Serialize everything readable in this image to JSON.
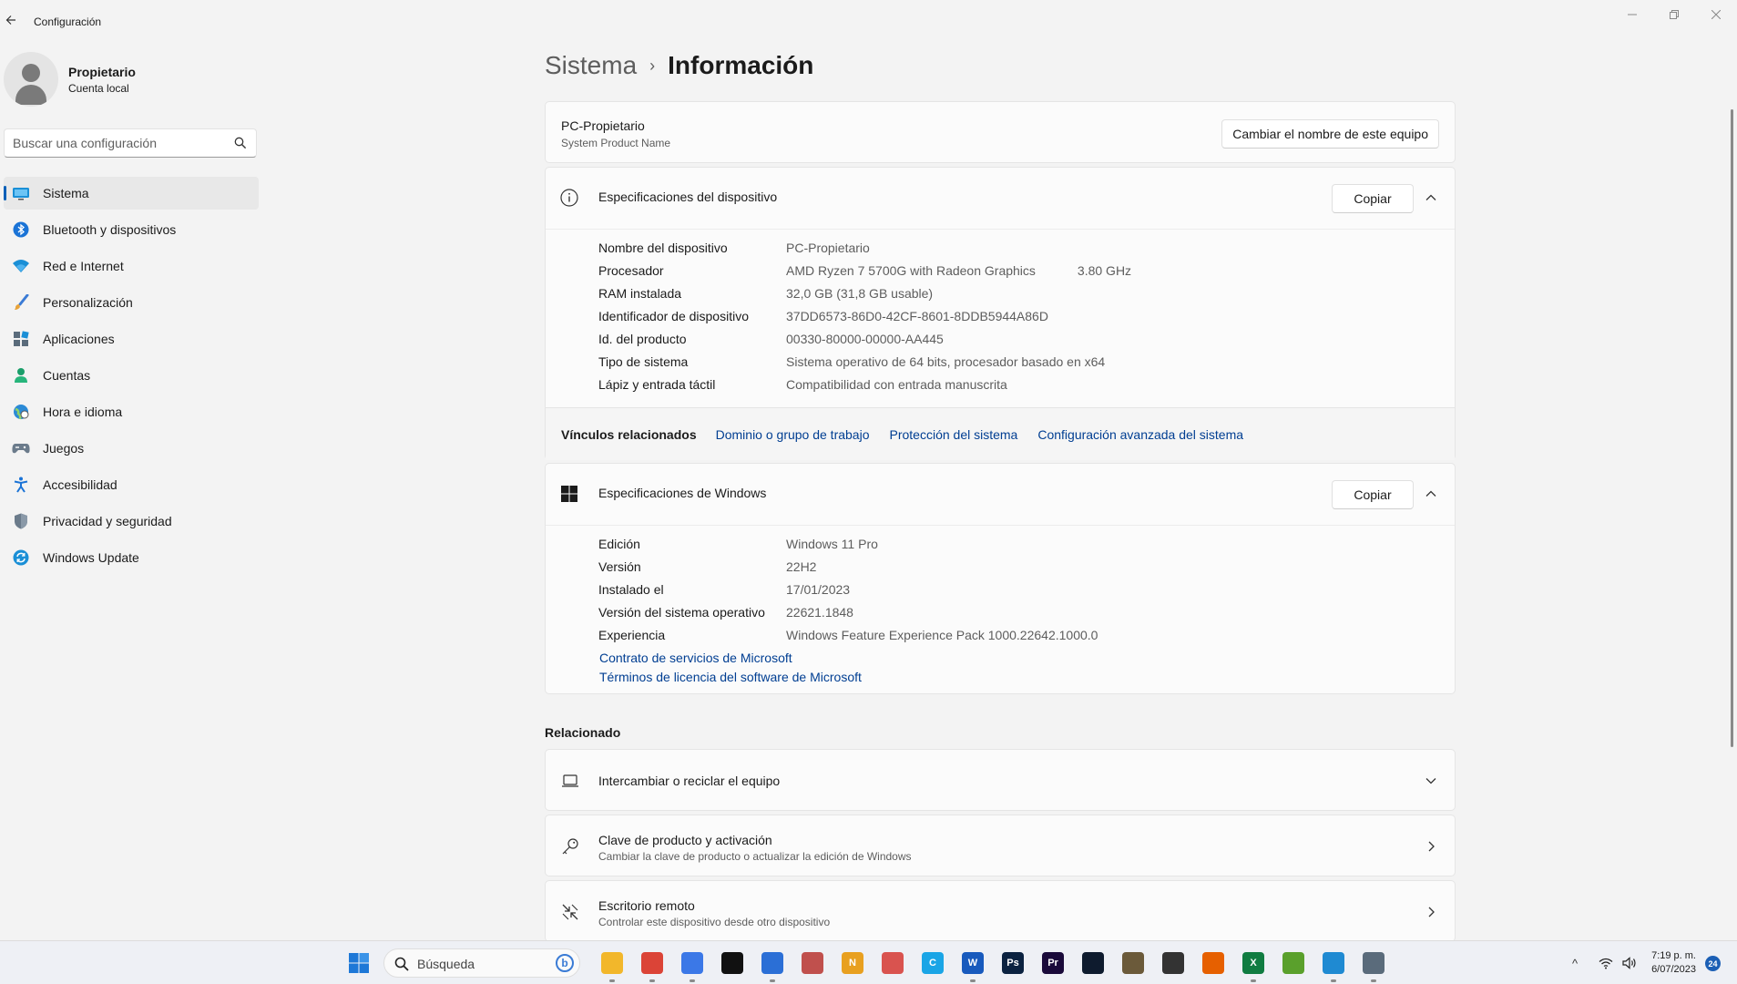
{
  "window": {
    "title": "Configuración"
  },
  "profile": {
    "name": "Propietario",
    "account_type": "Cuenta local"
  },
  "search": {
    "placeholder": "Buscar una configuración"
  },
  "sidebar": {
    "items": [
      {
        "label": "Sistema",
        "icon": "monitor-icon",
        "active": true
      },
      {
        "label": "Bluetooth y dispositivos",
        "icon": "bluetooth-icon"
      },
      {
        "label": "Red e Internet",
        "icon": "wifi-icon"
      },
      {
        "label": "Personalización",
        "icon": "brush-icon"
      },
      {
        "label": "Aplicaciones",
        "icon": "apps-icon"
      },
      {
        "label": "Cuentas",
        "icon": "person-icon"
      },
      {
        "label": "Hora e idioma",
        "icon": "globe-clock-icon"
      },
      {
        "label": "Juegos",
        "icon": "gamepad-icon"
      },
      {
        "label": "Accesibilidad",
        "icon": "accessibility-icon"
      },
      {
        "label": "Privacidad y seguridad",
        "icon": "shield-icon"
      },
      {
        "label": "Windows Update",
        "icon": "update-icon"
      }
    ]
  },
  "breadcrumb": {
    "parent": "Sistema",
    "separator": "›",
    "current": "Información"
  },
  "device_header": {
    "pc_name": "PC-Propietario",
    "product_name": "System Product Name",
    "rename_button": "Cambiar el nombre de este equipo"
  },
  "device_specs": {
    "title": "Especificaciones del dispositivo",
    "copy_button": "Copiar",
    "rows": [
      {
        "label": "Nombre del dispositivo",
        "value": "PC-Propietario"
      },
      {
        "label": "Procesador",
        "value": "AMD Ryzen 7 5700G with Radeon Graphics",
        "extra": "3.80 GHz"
      },
      {
        "label": "RAM instalada",
        "value": "32,0 GB (31,8 GB usable)"
      },
      {
        "label": "Identificador de dispositivo",
        "value": "37DD6573-86D0-42CF-8601-8DDB5944A86D"
      },
      {
        "label": "Id. del producto",
        "value": "00330-80000-00000-AA445"
      },
      {
        "label": "Tipo de sistema",
        "value": "Sistema operativo de 64 bits, procesador basado en x64"
      },
      {
        "label": "Lápiz y entrada táctil",
        "value": "Compatibilidad con entrada manuscrita"
      }
    ]
  },
  "related_links": {
    "label": "Vínculos relacionados",
    "links": [
      "Dominio o grupo de trabajo",
      "Protección del sistema",
      "Configuración avanzada del sistema"
    ]
  },
  "windows_specs": {
    "title": "Especificaciones de Windows",
    "copy_button": "Copiar",
    "rows": [
      {
        "label": "Edición",
        "value": "Windows 11 Pro"
      },
      {
        "label": "Versión",
        "value": "22H2"
      },
      {
        "label": "Instalado el",
        "value": "17/01/2023"
      },
      {
        "label": "Versión del sistema operativo",
        "value": "22621.1848"
      },
      {
        "label": "Experiencia",
        "value": "Windows Feature Experience Pack 1000.22642.1000.0"
      }
    ],
    "links": [
      "Contrato de servicios de Microsoft",
      "Términos de licencia del software de Microsoft"
    ]
  },
  "related": {
    "title": "Relacionado",
    "items": [
      {
        "title": "Intercambiar o reciclar el equipo",
        "subtitle": "",
        "icon": "laptop-icon"
      },
      {
        "title": "Clave de producto y activación",
        "subtitle": "Cambiar la clave de producto o actualizar la edición de Windows",
        "icon": "key-icon"
      },
      {
        "title": "Escritorio remoto",
        "subtitle": "Controlar este dispositivo desde otro dispositivo",
        "icon": "remote-desktop-icon"
      }
    ]
  },
  "taskbar": {
    "search_placeholder": "Búsqueda",
    "search_badge": "b",
    "apps": [
      {
        "name": "file-explorer-icon",
        "color": "#f2b72b",
        "label": ""
      },
      {
        "name": "chrome-icon",
        "color": "#db4437",
        "label": ""
      },
      {
        "name": "snipping-tool-icon",
        "color": "#3b78e7",
        "label": ""
      },
      {
        "name": "inkscape-icon",
        "color": "#111111",
        "label": ""
      },
      {
        "name": "photo-app-icon",
        "color": "#2b6fd6",
        "label": ""
      },
      {
        "name": "3d-app-icon",
        "color": "#c0504d",
        "label": ""
      },
      {
        "name": "notepad-plus-icon",
        "color": "#e8a020",
        "label": "N"
      },
      {
        "name": "sketchup-icon",
        "color": "#d9534f",
        "label": ""
      },
      {
        "name": "clipchamp-icon",
        "color": "#1aa5e6",
        "label": "C"
      },
      {
        "name": "word-icon",
        "color": "#185abd",
        "label": "W"
      },
      {
        "name": "photoshop-icon",
        "color": "#0b2240",
        "label": "Ps"
      },
      {
        "name": "premiere-icon",
        "color": "#1a0a3a",
        "label": "Pr"
      },
      {
        "name": "teamviewer-icon",
        "color": "#0e1b2e",
        "label": ""
      },
      {
        "name": "gimp-icon",
        "color": "#6b5a3a",
        "label": ""
      },
      {
        "name": "inkscape-alt-icon",
        "color": "#333333",
        "label": ""
      },
      {
        "name": "firefox-icon",
        "color": "#e66000",
        "label": ""
      },
      {
        "name": "excel-icon",
        "color": "#107c41",
        "label": "X"
      },
      {
        "name": "feather-app-icon",
        "color": "#5aa02c",
        "label": ""
      },
      {
        "name": "edge-icon",
        "color": "#1f8ad2",
        "label": ""
      },
      {
        "name": "settings-app-icon",
        "color": "#5a6b7b",
        "label": ""
      }
    ],
    "time": "7:19 p. m.",
    "date": "6/07/2023",
    "notifications": "24"
  }
}
